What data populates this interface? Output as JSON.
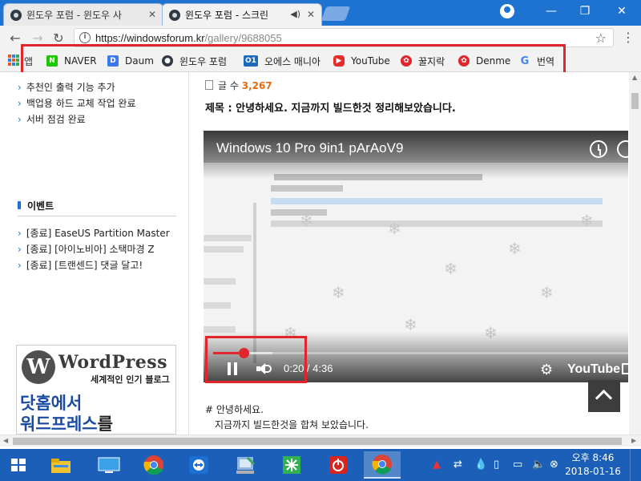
{
  "browser": {
    "tabs": [
      {
        "title": "윈도우 포럼 - 윈도우 사",
        "active": false
      },
      {
        "title": "윈도우 포럼 - 스크린",
        "active": true,
        "audio": "speaker-icon"
      }
    ],
    "url_host": "https://windowsforum.kr",
    "url_path": "/gallery/9688055",
    "apps_label": "앱",
    "bookmarks": [
      {
        "label": "NAVER",
        "icon": "naver-icon",
        "color": "#1ec800"
      },
      {
        "label": "Daum",
        "icon": "daum-icon",
        "color": "#3c78f0"
      },
      {
        "label": "윈도우 포럼",
        "icon": "windowsforum-icon",
        "color": "#2f3a45"
      },
      {
        "label": "오에스 매니아",
        "icon": "osmania-icon",
        "color": "#1b6ab8"
      },
      {
        "label": "YouTube",
        "icon": "youtube-icon",
        "color": "#e52d27"
      },
      {
        "label": "꿀지락",
        "icon": "ggul-icon",
        "color": "#e0262c"
      },
      {
        "label": "Denme",
        "icon": "denme-icon",
        "color": "#e0262c"
      },
      {
        "label": "번역",
        "icon": "google-icon",
        "color": "#4285f4"
      }
    ],
    "highlight_color": "#e0262c"
  },
  "sidebar": {
    "links": [
      "추천인 출력 기능 추가",
      "백업용 하드 교체 작업 완료",
      "서버 점검 완료"
    ],
    "event_title": "이벤트",
    "events": [
      "[종료] EaseUS Partition Master",
      "[종료] [아이노비아] 소택마경 Z",
      "[종료] [트랜센드] 댓글 달고!"
    ],
    "ad": {
      "logo_letter": "W",
      "brand": "WordPress",
      "subtitle": "세계적인 인기 블로그",
      "line1": "닷홈에서",
      "line2_a": "워드프레스",
      "line2_b": "를"
    }
  },
  "post": {
    "comment_label": "글 수",
    "comment_count": "3,267",
    "title": "제목 : 안녕하세요. 지금까지 빌드한것 정리해보았습니다.",
    "body": [
      "#  안녕하세요.",
      "지금까지 빌드한것을 합쳐 보았습니다."
    ]
  },
  "video": {
    "title": "Windows 10 Pro 9in1 pArAoV9",
    "current_time": "0:20",
    "duration": "4:36",
    "time_separator": " / ",
    "progress_fraction": 0.0725,
    "youtube_label": "YouTube",
    "explorer_rows": [
      "Virtual CloneDrive",
      "Windows 10 Pro 9in1 pArAoV9",
      "WIM 파일",
      "Windows 10 Pro 9in1 pArAoV9"
    ]
  },
  "taskbar": {
    "apps": [
      "file-explorer-icon",
      "desktop-icon",
      "chrome-icon",
      "teamviewer-icon",
      "network-setup-icon",
      "power-icon",
      "chrome-active-icon"
    ],
    "clock_time": "오후 8:46",
    "clock_date": "2018-01-16"
  }
}
